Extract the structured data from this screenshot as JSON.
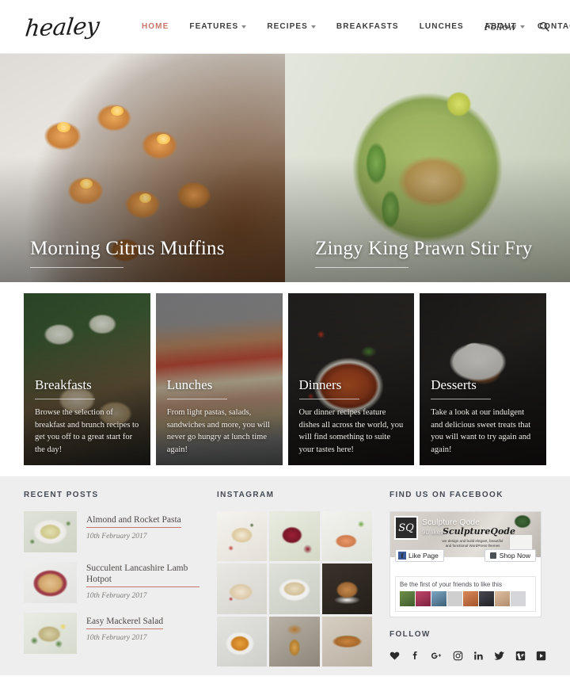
{
  "header": {
    "logo": "healey",
    "nav": [
      {
        "label": "HOME",
        "active": true,
        "caret": false
      },
      {
        "label": "FEATURES",
        "active": false,
        "caret": true
      },
      {
        "label": "RECIPES",
        "active": false,
        "caret": true
      },
      {
        "label": "BREAKFASTS",
        "active": false,
        "caret": false
      },
      {
        "label": "LUNCHES",
        "active": false,
        "caret": false
      },
      {
        "label": "ABOUT",
        "active": false,
        "caret": false
      },
      {
        "label": "CONTACT",
        "active": false,
        "caret": false
      }
    ],
    "follow_label": "Follow",
    "search_icon": "search-icon",
    "active_color": "#c8766b"
  },
  "hero": [
    {
      "title": "Morning Citrus Muffins",
      "image": "muffins-photo"
    },
    {
      "title": "Zingy King Prawn Stir Fry",
      "image": "prawn-stir-fry-photo"
    }
  ],
  "categories": [
    {
      "title": "Breakfasts",
      "text": "Browse the selection of breakfast and brunch recipes to get you off to a great start for the day!",
      "image": "breakfast-photo"
    },
    {
      "title": "Lunches",
      "text": "From light pastas, salads, sandwiches and more, you will never go hungry at lunch time again!",
      "image": "lunch-photo"
    },
    {
      "title": "Dinners",
      "text": "Our dinner recipes feature dishes all across the world, you will find something to suite your tastes here!",
      "image": "dinner-photo"
    },
    {
      "title": "Desserts",
      "text": "Take a look at our indulgent and delicious sweet treats that you will want to try again and again!",
      "image": "dessert-photo"
    }
  ],
  "footer": {
    "recent": {
      "title": "RECENT POSTS",
      "posts": [
        {
          "title": "Almond and Rocket Pasta",
          "date": "10th February 2017",
          "thumb": "pasta-thumb"
        },
        {
          "title": "Succulent Lancashire Lamb Hotpot",
          "date": "10th February 2017",
          "thumb": "hotpot-thumb"
        },
        {
          "title": "Easy Mackerel Salad",
          "date": "10th February 2017",
          "thumb": "mackerel-thumb"
        }
      ]
    },
    "instagram": {
      "title": "INSTAGRAM",
      "cells": [
        "salad-plate-photo",
        "pomegranate-tart-photo",
        "smoked-salmon-toast-photo",
        "macarons-photo",
        "lemon-meringue-pie-photo",
        "burger-photo",
        "pumpkin-soup-photo",
        "whiskey-pour-photo",
        "club-sandwich-photo"
      ]
    },
    "facebook": {
      "title": "FIND US ON FACEBOOK",
      "page_name": "Sculpture Qode",
      "likes": "90 likes",
      "avatar_initials": "SQ",
      "brand_script": "SculptureQode",
      "tagline": "we design and build elegant, beautiful and functional WordPress themes",
      "like_button": "Like Page",
      "shop_button": "Shop Now",
      "friends_text": "Be the first of your friends to like this",
      "friend_avatar_count": 8
    },
    "follow": {
      "title": "FOLLOW",
      "socials": [
        "heart-icon",
        "facebook-icon",
        "google-plus-icon",
        "instagram-icon",
        "linkedin-icon",
        "twitter-icon",
        "vimeo-icon",
        "youtube-icon"
      ]
    }
  }
}
